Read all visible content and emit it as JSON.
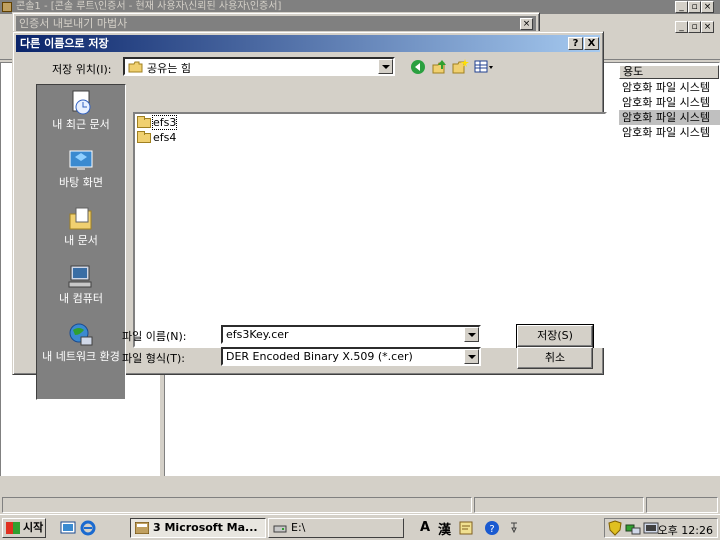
{
  "mmc": {
    "title": "콘솔1 - [콘솔 루트\\인증서 - 현재 사용자\\신뢰된 사용자\\인증서]",
    "column_header": "용도",
    "purpose_rows": [
      "암호화 파일 시스템",
      "암호화 파일 시스템",
      "암호화 파일 시스템",
      "암호화 파일 시스템"
    ],
    "selected_row_index": 2
  },
  "wizard": {
    "title": "인증서 내보내기 마법사"
  },
  "dialog": {
    "title": "다른 이름으로 저장",
    "help_btn": "?",
    "close_btn": "X",
    "save_in_label": "저장 위치(I):",
    "save_in_value": "공유는 힘",
    "places": [
      {
        "label": "내 최근 문서",
        "icon": "recent-documents-icon"
      },
      {
        "label": "바탕 화면",
        "icon": "desktop-icon"
      },
      {
        "label": "내 문서",
        "icon": "my-documents-icon"
      },
      {
        "label": "내 컴퓨터",
        "icon": "my-computer-icon"
      },
      {
        "label": "내 네트워크 환경",
        "icon": "network-icon"
      }
    ],
    "files": [
      "efs3",
      "efs4"
    ],
    "filename_label": "파일 이름(N):",
    "filename_value": "efs3Key.cer",
    "filetype_label": "파일 형식(T):",
    "filetype_value": "DER Encoded Binary X.509 (*.cer)",
    "save_btn": "저장(S)",
    "cancel_btn": "취소"
  },
  "taskbar": {
    "start_label": "시작",
    "tasks": [
      "3 Microsoft Ma...",
      "E:\\"
    ],
    "ime_a": "A",
    "ime_han": "漢",
    "clock": "오후 12:26"
  }
}
